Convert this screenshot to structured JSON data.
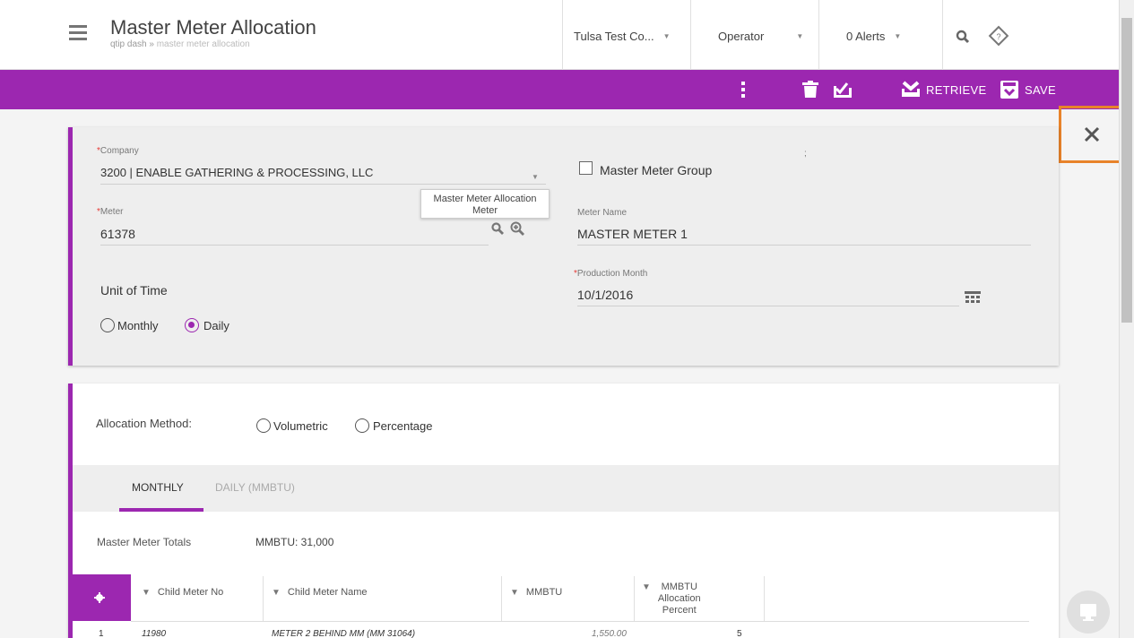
{
  "header": {
    "title": "Master Meter Allocation",
    "breadcrumb_root": "qtip dash",
    "breadcrumb_sep": "»",
    "breadcrumb_current": "master meter allocation",
    "company_selector": "Tulsa Test Co...",
    "role_selector": "Operator",
    "alerts": "0 Alerts"
  },
  "toolbar": {
    "retrieve_label": "RETRIEVE",
    "save_label": "SAVE",
    "color": "#9c27b0"
  },
  "form": {
    "company_label": "Company",
    "company_value": "3200 | ENABLE GATHERING & PROCESSING, LLC",
    "master_meter_group_label": "Master Meter Group",
    "stray_text": ";",
    "meter_label": "Meter",
    "meter_value": "61378",
    "meter_tooltip_line1": "Master Meter Allocation",
    "meter_tooltip_line2": "Meter",
    "meter_name_label": "Meter Name",
    "meter_name_value": "MASTER METER 1",
    "unit_of_time_label": "Unit of Time",
    "monthly_label": "Monthly",
    "daily_label": "Daily",
    "production_month_label": "Production Month",
    "production_month_value": "10/1/2016"
  },
  "allocation": {
    "method_label": "Allocation Method:",
    "volumetric_label": "Volumetric",
    "percentage_label": "Percentage",
    "tabs": [
      {
        "label": "MONTHLY",
        "active": true
      },
      {
        "label": "DAILY (MMBTU)",
        "active": false
      }
    ],
    "totals_label": "Master Meter Totals",
    "totals_value": "MMBTU: 31,000"
  },
  "grid": {
    "columns": [
      "Child Meter No",
      "Child Meter Name",
      "MMBTU",
      "MMBTU",
      "Allocation",
      "Percent"
    ],
    "rows": [
      {
        "index": "1",
        "meter_no": "11980",
        "meter_name": "METER 2 BEHIND MM (MM 31064)",
        "mmbtu": "1,550.00",
        "percent": "5"
      }
    ]
  }
}
